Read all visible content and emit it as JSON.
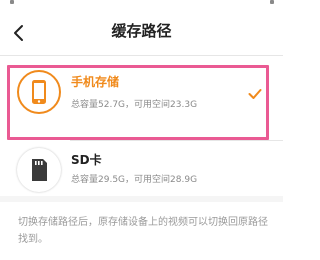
{
  "header": {
    "title": "缓存路径"
  },
  "options": [
    {
      "name": "手机存储",
      "total": "总容量52.7G",
      "free": "可用空间23.3G",
      "selected": true,
      "icon": "phone-icon"
    },
    {
      "name": "SD卡",
      "total": "总容量29.5G",
      "free": "可用空间28.9G",
      "selected": false,
      "icon": "sd-card-icon"
    }
  ],
  "hint": "切换存储路径后，原存储设备上的视频可以切换回原路径找到。",
  "colors": {
    "accent": "#f08a1c",
    "highlight_frame": "#ea5a93"
  }
}
